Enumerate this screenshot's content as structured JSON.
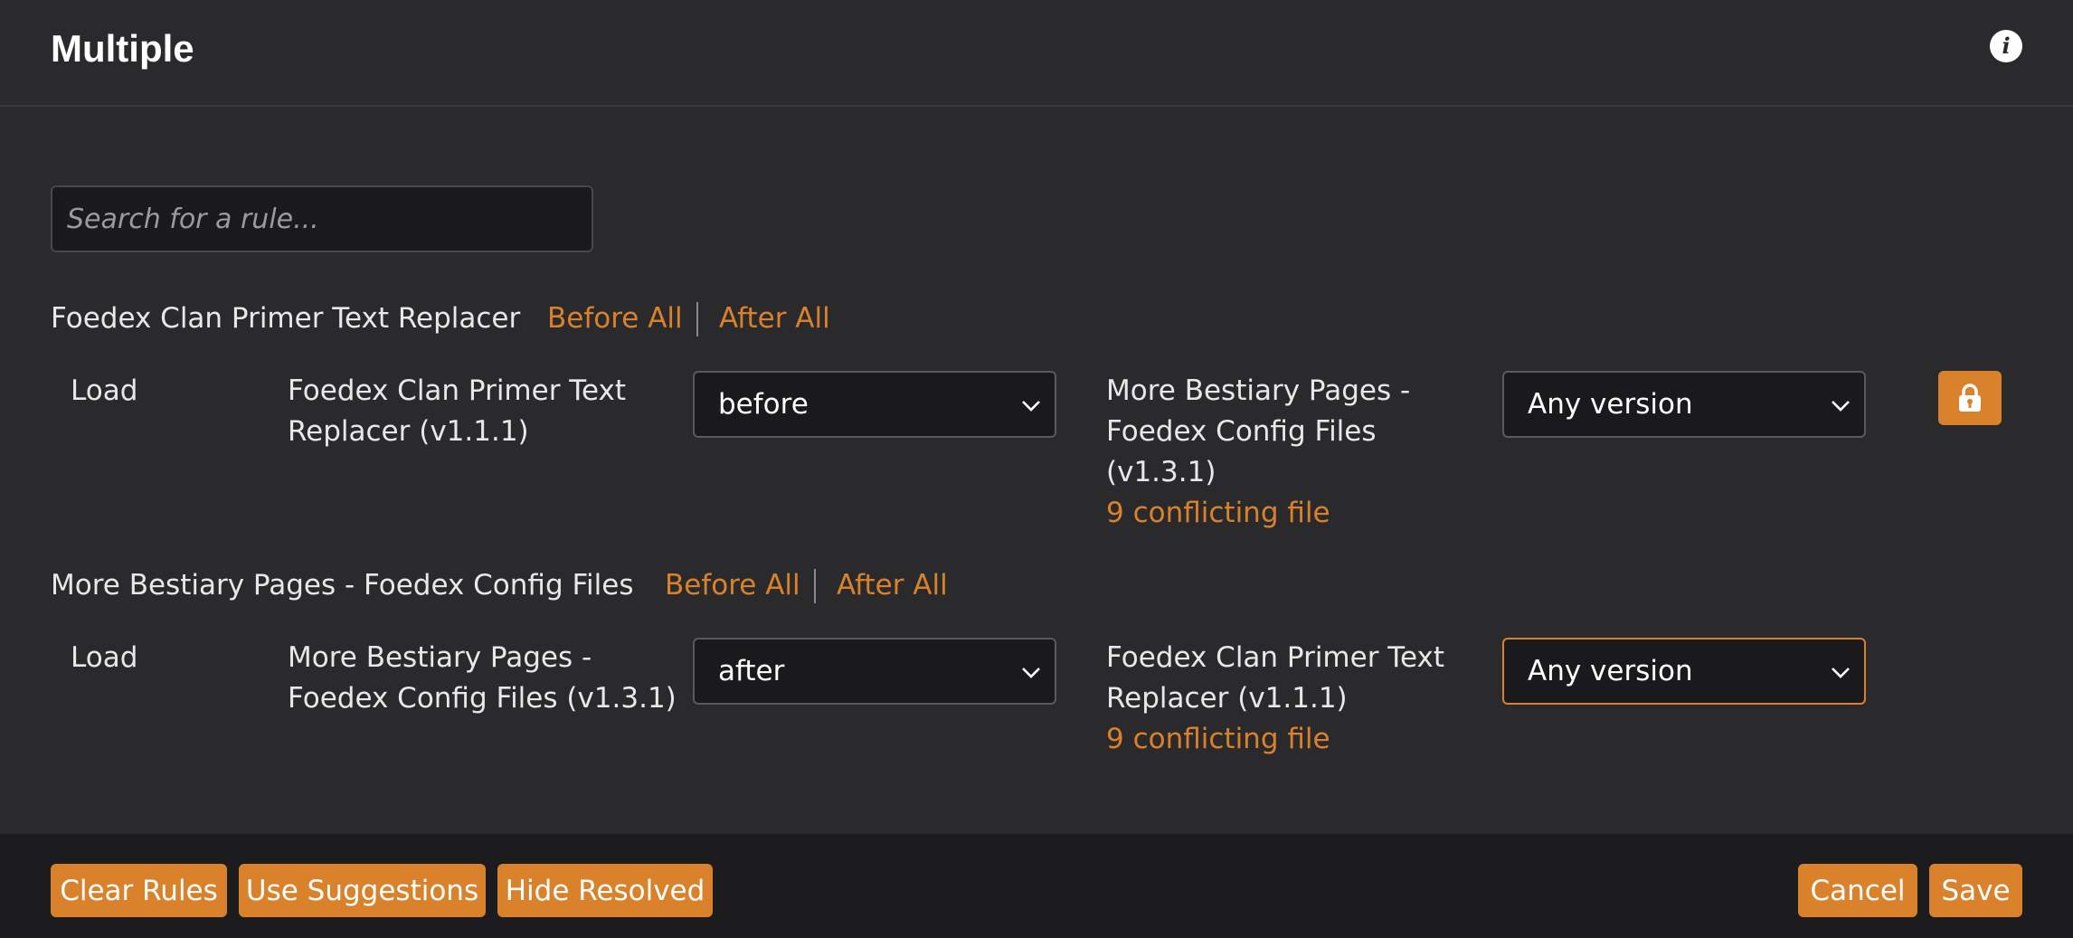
{
  "header": {
    "title": "Multiple"
  },
  "search": {
    "placeholder": "Search for a rule..."
  },
  "groups": [
    {
      "name": "Foedex Clan Primer Text Replacer",
      "before_all": "Before All",
      "after_all": "After All",
      "rule": {
        "action": "Load",
        "source_line1": "Foedex Clan Primer Text",
        "source_line2": "Replacer (v1.1.1)",
        "order": "before",
        "target_line1": "More Bestiary Pages -",
        "target_line2": "Foedex Config Files",
        "target_line3": "(v1.3.1)",
        "conflicts": "9 conflicting file",
        "version": "Any version"
      }
    },
    {
      "name": "More Bestiary Pages - Foedex Config Files",
      "before_all": "Before All",
      "after_all": "After All",
      "rule": {
        "action": "Load",
        "source_line1": "More Bestiary Pages -",
        "source_line2": "Foedex Config Files (v1.3.1)",
        "order": "after",
        "target_line1": "Foedex Clan Primer Text",
        "target_line2": "Replacer (v1.1.1)",
        "conflicts": "9 conflicting file",
        "version": "Any version"
      }
    }
  ],
  "footer": {
    "clear_rules": "Clear Rules",
    "use_suggestions": "Use Suggestions",
    "hide_resolved": "Hide Resolved",
    "cancel": "Cancel",
    "save": "Save"
  },
  "colors": {
    "accent": "#d9822b",
    "background": "#2a2a2d",
    "footer": "#1c1c1e"
  },
  "icons": {
    "info": "info-icon",
    "lock": "lock-icon",
    "chevron": "chevron-down-icon"
  }
}
